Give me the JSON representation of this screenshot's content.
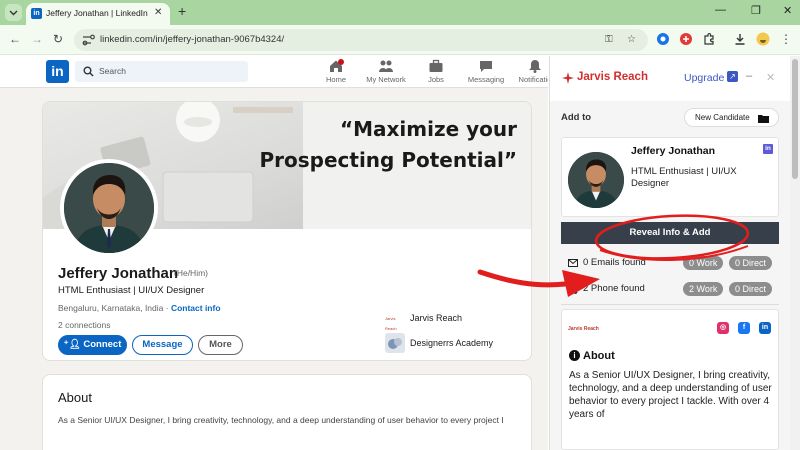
{
  "browser": {
    "tab_title": "Jeffery Jonathan | LinkedIn",
    "tab_favicon": "in",
    "url": "linkedin.com/in/jeffery-jonathan-9067b4324/"
  },
  "linkedin": {
    "logo": "in",
    "search_placeholder": "Search",
    "nav": [
      {
        "label": "Home",
        "icon": "home-icon"
      },
      {
        "label": "My Network",
        "icon": "network-icon"
      },
      {
        "label": "Jobs",
        "icon": "briefcase-icon"
      },
      {
        "label": "Messaging",
        "icon": "chat-icon"
      },
      {
        "label": "Notificatio",
        "icon": "bell-icon"
      }
    ],
    "banner_quote": [
      "“Maximize your",
      "Prospecting Potential”"
    ],
    "profile": {
      "name": "Jeffery Jonathan",
      "pronouns": "(He/Him)",
      "headline": "HTML Enthusiast | UI/UX Designer",
      "location": "Bengaluru, Karnataka, India · ",
      "contact_info": "Contact info",
      "connections": "2 connections"
    },
    "buttons": {
      "connect": "Connect",
      "message": "Message",
      "more": "More"
    },
    "experience": [
      {
        "logo_text": "Jarvis Reach",
        "label": "Jarvis Reach"
      },
      {
        "label": "Designerrs Academy"
      }
    ],
    "about": {
      "title": "About",
      "text": "As a Senior UI/UX Designer, I bring creativity, technology, and a deep understanding of user behavior to every project I"
    }
  },
  "jarvis": {
    "brand": "Jarvis Reach",
    "upgrade": "Upgrade",
    "minimize": "–",
    "close": "✕",
    "add_to": "Add to",
    "new_candidate": "New Candidate",
    "candidate": {
      "name": "Jeffery Jonathan",
      "headline": "HTML Enthusiast | UI/UX Designer"
    },
    "reveal_button": "Reveal Info & Add",
    "emails": {
      "label": "0 Emails found",
      "work": "0 Work",
      "direct": "0 Direct"
    },
    "phones": {
      "label": "2 Phone found",
      "work": "2 Work",
      "direct": "0 Direct"
    },
    "about_logo": "Jarvis Reach",
    "about_heading": "About",
    "about_text": "As a Senior UI/UX Designer, I bring creativity, technology, and a deep understanding of user behavior to every project I tackle. With over 4 years of",
    "colors": {
      "brand_red": "#d32f2f",
      "upgrade_blue": "#3d57c4",
      "reveal_bg": "#37404a",
      "linkedin_blue": "#0a66c2"
    }
  }
}
